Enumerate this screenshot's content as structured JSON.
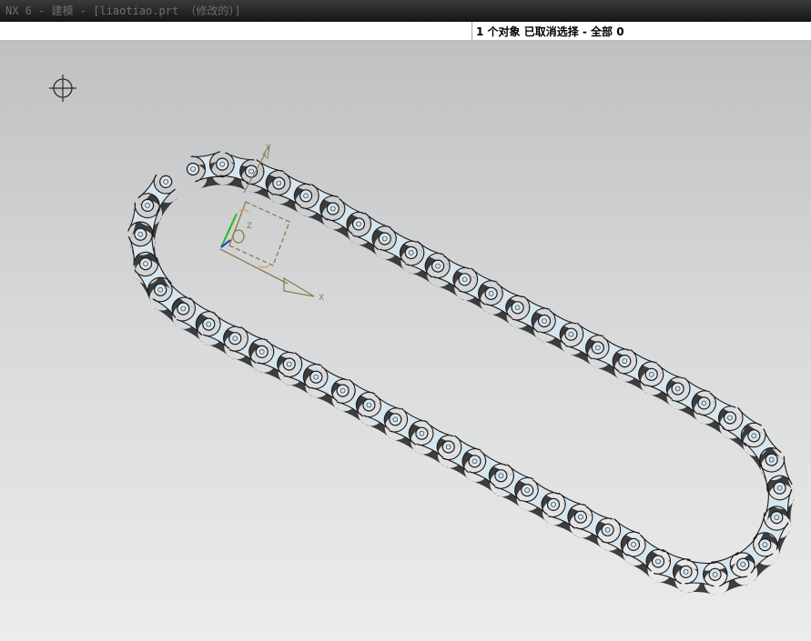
{
  "window": {
    "title": "NX 6 - 建模 - [liaotiao.prt （修改的）]"
  },
  "status": {
    "selection_message": "1 个对象 已取消选择  - 全部 0"
  },
  "csys": {
    "x_label": "X",
    "y_label": "Y",
    "z_label": "Z"
  },
  "colors": {
    "link_fill": "#d7e6ee",
    "link_outline": "#1a1a1a",
    "shadow": "#2b2b2b",
    "csys_color": "#8b7d4e",
    "y_axis_green": "#16c316",
    "z_axis_blue": "#1f35c8",
    "background_top": "#bfc0c1",
    "background_bottom": "#ececec"
  },
  "icons": {
    "cursor": "crosshair-cursor-icon",
    "wcs": "csys-triad-icon"
  }
}
